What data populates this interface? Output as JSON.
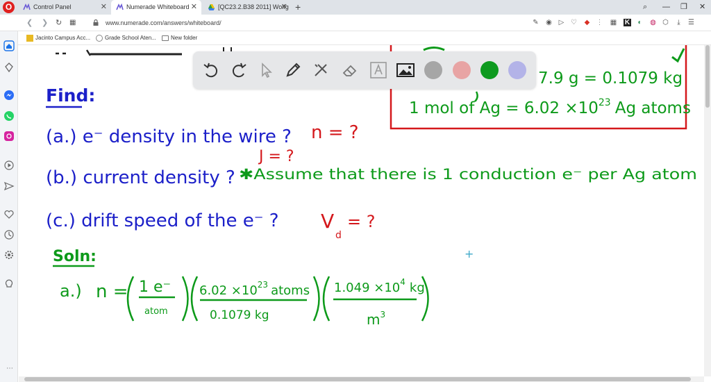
{
  "browser": {
    "logo_letter": "O",
    "tabs": [
      {
        "label": "Control Panel",
        "active": false
      },
      {
        "label": "Numerade Whiteboard",
        "active": true
      },
      {
        "label": "[QC23.2.B38 2011] Wolfg",
        "active": false
      }
    ],
    "new_tab": "+",
    "url": "www.numerade.com/answers/whiteboard/",
    "bookmarks": [
      {
        "label": "Jacinto Campus Acc..."
      },
      {
        "label": "Grade School Aten..."
      },
      {
        "label": "New folder"
      }
    ]
  },
  "toolbar": {
    "tools": [
      "undo-icon",
      "redo-icon",
      "select-icon",
      "pen-icon",
      "tools-icon",
      "eraser-icon",
      "text-icon",
      "image-icon"
    ],
    "colors": [
      "#a6a6a6",
      "#e8a4a4",
      "#0e9a1f",
      "#b3b3e8"
    ],
    "selected_color": "#0e9a1f"
  },
  "whiteboard": {
    "ink_colors": {
      "blue": "#1c20c9",
      "red": "#d4181c",
      "green": "#0d9a1a"
    },
    "find": "Find:",
    "a_line": "(a.) e⁻ density in the wire ?",
    "a_var": "n = ?",
    "b_line": "(b.) current density ?",
    "b_var": "J = ?",
    "b_assume": "✱Assume that there is 1 conduction e⁻ per Ag atom",
    "c_line": "(c.) drift speed of the e⁻ ?",
    "c_var": "V",
    "c_sub": "d",
    "c_eq": "= ?",
    "soln": "Soln:",
    "a_label": "a.)",
    "n_eq": "n =",
    "f1_num": "1 e⁻",
    "f1_den": "atom",
    "f2_num": "6.02 ×10",
    "f2_exp": "23",
    "f2_num_unit": "atoms",
    "f2_den": "0.1079 kg",
    "f3_num": "1.049 ×10",
    "f3_exp": "4",
    "f3_num_unit": "kg",
    "f3_den": "m",
    "f3_den_exp": "3",
    "box_line1": "7.9 g = 0.1079 kg",
    "box_line2_a": "1 mol of Ag = 6.02 ×10",
    "box_line2_exp": "23",
    "box_line2_b": "Ag atoms",
    "cursor": "+"
  }
}
